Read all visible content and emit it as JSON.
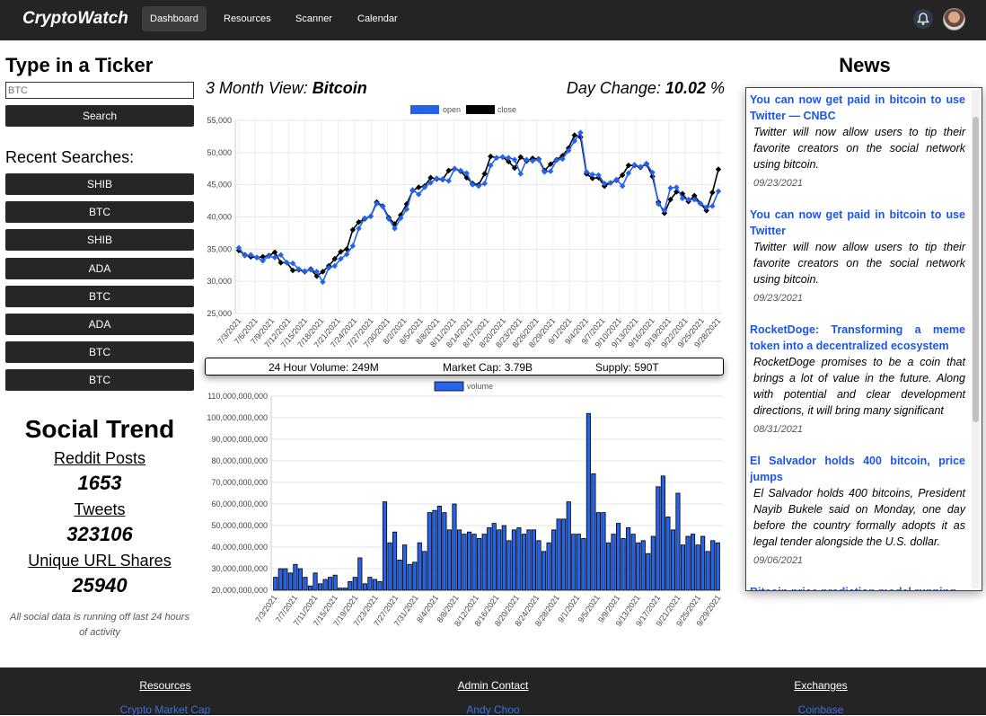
{
  "nav": {
    "brand": "CryptoWatch",
    "items": [
      "Dashboard",
      "Resources",
      "Scanner",
      "Calendar"
    ],
    "active": "Dashboard"
  },
  "ticker": {
    "title": "Type in a Ticker",
    "placeholder": "BTC",
    "search_label": "Search",
    "recent_title": "Recent Searches:",
    "recent": [
      "SHIB",
      "BTC",
      "SHIB",
      "ADA",
      "BTC",
      "ADA",
      "BTC",
      "BTC"
    ]
  },
  "social": {
    "title": "Social Trend",
    "reddit_label": "Reddit Posts",
    "reddit_value": "1653",
    "tweets_label": "Tweets",
    "tweets_value": "323106",
    "url_label": "Unique URL Shares",
    "url_value": "25940",
    "note": "All social data is running off last 24 hours of activity"
  },
  "overview": {
    "view_label": "3 Month View:",
    "coin": "Bitcoin",
    "day_change_label": "Day Change:",
    "day_change_value": "10.02",
    "day_change_unit": "%",
    "volume_24h": "24 Hour Volume: 249M",
    "market_cap": "Market Cap: 3.79B",
    "supply": "Supply: 590T"
  },
  "chart_data": [
    {
      "type": "line",
      "legend": [
        "open",
        "close"
      ],
      "colors": {
        "open": "#2563eb",
        "close": "#000000"
      },
      "ylim": [
        25000,
        55000
      ],
      "yticks": [
        "55,000",
        "50,000",
        "45,000",
        "40,000",
        "35,000",
        "30,000",
        "25,000"
      ],
      "x_ticks": [
        "7/3/2021",
        "7/6/2021",
        "7/9/2021",
        "7/12/2021",
        "7/15/2021",
        "7/18/2021",
        "7/21/2021",
        "7/24/2021",
        "7/27/2021",
        "7/30/2021",
        "8/2/2021",
        "8/5/2021",
        "8/8/2021",
        "8/11/2021",
        "8/14/2021",
        "8/17/2021",
        "8/20/2021",
        "8/23/2021",
        "8/26/2021",
        "8/29/2021",
        "9/1/2021",
        "9/4/2021",
        "9/7/2021",
        "9/10/2021",
        "9/13/2021",
        "9/16/2021",
        "9/19/2021",
        "9/22/2021",
        "9/25/2021",
        "9/28/2021"
      ],
      "open": [
        35200,
        34000,
        34100,
        33700,
        33200,
        33900,
        33700,
        34100,
        32900,
        32800,
        31900,
        31600,
        31800,
        31500,
        29900,
        32100,
        32400,
        33500,
        34200,
        35500,
        38200,
        39800,
        40100,
        42100,
        41600,
        39700,
        38200,
        39800,
        41200,
        44200,
        43500,
        44600,
        45300,
        46000,
        45900,
        45600,
        47500,
        47200,
        46800,
        45000,
        44800,
        45200,
        48000,
        49200,
        49300,
        49200,
        48900,
        46700,
        48900,
        48700,
        48900,
        47000,
        47100,
        48800,
        49000,
        50300,
        51800,
        53100,
        47000,
        46600,
        46500,
        45200,
        45300,
        45800,
        44800,
        46800,
        48100,
        47800,
        48300,
        46900,
        42000,
        41000,
        44500,
        44600,
        42900,
        42700,
        42700,
        42100,
        41500,
        41700,
        44000
      ],
      "close": [
        34800,
        34100,
        33800,
        33700,
        33800,
        34000,
        34500,
        32900,
        32900,
        31700,
        31800,
        31500,
        31900,
        30800,
        31500,
        32400,
        33500,
        34600,
        35000,
        38000,
        39200,
        39700,
        40100,
        42300,
        41700,
        39900,
        38900,
        40300,
        42000,
        44100,
        44600,
        44800,
        46100,
        45900,
        45800,
        47200,
        47500,
        47100,
        46100,
        45200,
        45000,
        46700,
        49400,
        49200,
        49300,
        48600,
        47600,
        49300,
        48700,
        49100,
        49000,
        47200,
        48200,
        48900,
        49500,
        50700,
        52700,
        52400,
        46700,
        46000,
        46100,
        44800,
        45300,
        45700,
        46500,
        48000,
        48000,
        47700,
        48200,
        46300,
        42300,
        40600,
        42700,
        43900,
        43600,
        42400,
        43300,
        42100,
        41000,
        43800,
        47400
      ]
    },
    {
      "type": "bar",
      "legend": [
        "volume"
      ],
      "colors": {
        "volume": "#2563eb"
      },
      "ylim": [
        20000000000,
        110000000000
      ],
      "yticks": [
        "110,000,000,000",
        "100,000,000,000",
        "90,000,000,000",
        "80,000,000,000",
        "70,000,000,000",
        "60,000,000,000",
        "50,000,000,000",
        "40,000,000,000",
        "30,000,000,000",
        "20,000,000,000"
      ],
      "x_ticks": [
        "7/3/2021",
        "7/7/2021",
        "7/11/2021",
        "7/15/2021",
        "7/19/2021",
        "7/23/2021",
        "7/27/2021",
        "7/31/2021",
        "8/4/2021",
        "8/8/2021",
        "8/12/2021",
        "8/16/2021",
        "8/20/2021",
        "8/24/2021",
        "8/28/2021",
        "9/1/2021",
        "9/5/2021",
        "9/9/2021",
        "9/13/2021",
        "9/17/2021",
        "9/21/2021",
        "9/25/2021",
        "9/29/2021"
      ],
      "values_billion": [
        26,
        30,
        30,
        28,
        32,
        30,
        26,
        22,
        28,
        23,
        25,
        26,
        27,
        21,
        21,
        24,
        26,
        35,
        23,
        26,
        25,
        24,
        61,
        42,
        47,
        34,
        41,
        32,
        33,
        42,
        38,
        56,
        57,
        59,
        56,
        48,
        60,
        48,
        46,
        47,
        46,
        44,
        46,
        49,
        51,
        48,
        50,
        43,
        48,
        49,
        46,
        48,
        48,
        43,
        38,
        42,
        48,
        53,
        53,
        61,
        46,
        46,
        44,
        102,
        74,
        56,
        56,
        42,
        46,
        51,
        44,
        49,
        46,
        42,
        43,
        37,
        45,
        68,
        73,
        54,
        48,
        65,
        41,
        45,
        46,
        41,
        45,
        38,
        43,
        42
      ]
    }
  ],
  "news": {
    "title": "News",
    "items": [
      {
        "headline": "You can now get paid in bitcoin to use Twitter — CNBC",
        "body": "Twitter will now allow users to tip their favorite creators on the social network using bitcoin.",
        "date": "09/23/2021"
      },
      {
        "headline": "You can now get paid in bitcoin to use Twitter",
        "body": "Twitter will now allow users to tip their favorite creators on the social network using bitcoin.",
        "date": "09/23/2021"
      },
      {
        "headline": "RocketDoge: Transforming a meme token into a decentralized ecosystem",
        "body": "RocketDoge promises to be a coin that brings a lot of value in the future. Along with potential and clear development directions, it will bring many significant",
        "date": "08/31/2021"
      },
      {
        "headline": "El Salvador holds 400 bitcoin, price jumps",
        "body": "El Salvador holds 400 bitcoins, President Nayib Bukele said on Monday, one day before the country formally adopts it as legal tender alongside the U.S. dollar.",
        "date": "09/06/2021"
      },
      {
        "headline": "Bitcoin price prediction model running",
        "body": "",
        "date": ""
      }
    ]
  },
  "footer": {
    "resources_title": "Resources",
    "resources_link": "Crypto Market Cap",
    "admin_title": "Admin Contact",
    "admin_link": "Andy Choo",
    "exchanges_title": "Exchanges",
    "exchanges_link": "Coinbase"
  }
}
